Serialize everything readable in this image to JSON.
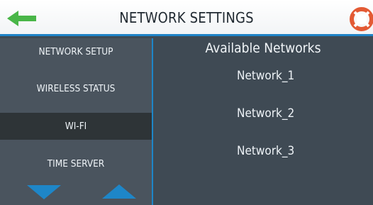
{
  "header": {
    "title": "NETWORK SETTINGS",
    "back_icon": "back-arrow-icon",
    "help_icon": "lifebuoy-icon"
  },
  "sidebar": {
    "items": [
      {
        "label": "NETWORK SETUP",
        "selected": false
      },
      {
        "label": "WIRELESS STATUS",
        "selected": false
      },
      {
        "label": "WI-FI",
        "selected": true
      },
      {
        "label": "TIME SERVER",
        "selected": false
      }
    ],
    "scroll_down_icon": "triangle-down-icon",
    "scroll_up_icon": "triangle-up-icon"
  },
  "main": {
    "title": "Available Networks",
    "networks": [
      "Network_1",
      "Network_2",
      "Network_3"
    ]
  },
  "colors": {
    "background": "#3f4a54",
    "sidebar": "#4a545e",
    "selected": "#2e3437",
    "accent": "#1e86c8",
    "back_arrow": "#49b648",
    "help_ring": "#e35a34"
  }
}
